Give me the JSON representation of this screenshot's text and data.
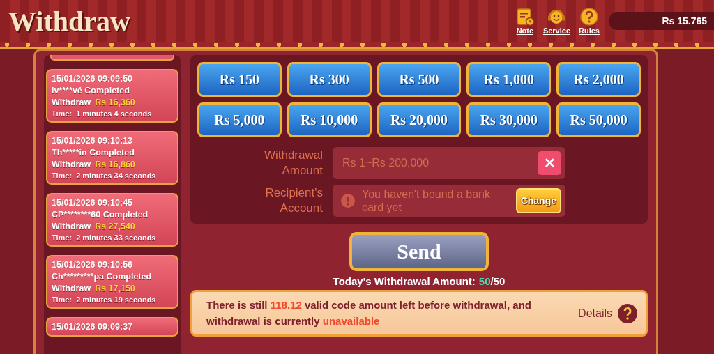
{
  "header": {
    "title": "Withdraw",
    "links": [
      {
        "kind": "note",
        "label": "Note"
      },
      {
        "kind": "service",
        "label": "Service"
      },
      {
        "kind": "rules",
        "label": "Rules"
      }
    ],
    "balance": "Rs 15.765"
  },
  "history": [
    {
      "date": "15/01/2026 09:09:50",
      "user": "Iv****vé Completed",
      "action": "Withdraw",
      "amount": "Rs 16,360",
      "time_label": "Time:",
      "duration": "1 minutes 4 seconds"
    },
    {
      "date": "15/01/2026 09:10:13",
      "user": "Th*****in Completed",
      "action": "Withdraw",
      "amount": "Rs 16,860",
      "time_label": "Time:",
      "duration": "2 minutes 34 seconds"
    },
    {
      "date": "15/01/2026 09:10:45",
      "user": "CP********60 Completed",
      "action": "Withdraw",
      "amount": "Rs 27,540",
      "time_label": "Time:",
      "duration": "2 minutes 33 seconds"
    },
    {
      "date": "15/01/2026 09:10:56",
      "user": "Ch*********pa Completed",
      "action": "Withdraw",
      "amount": "Rs 17,150",
      "time_label": "Time:",
      "duration": "2 minutes 19 seconds"
    },
    {
      "date": "15/01/2026 09:09:37"
    }
  ],
  "amounts": [
    "Rs 150",
    "Rs 300",
    "Rs 500",
    "Rs 1,000",
    "Rs 2,000",
    "Rs 5,000",
    "Rs 10,000",
    "Rs 20,000",
    "Rs 30,000",
    "Rs 50,000"
  ],
  "form": {
    "amount_label": "Withdrawal Amount",
    "amount_placeholder": "Rs 1~Rs 200,000",
    "clear_button": "✕",
    "account_label": "Recipient's Account",
    "account_message": "You haven't bound a bank card yet",
    "change_button": "Change"
  },
  "send_button": "Send",
  "today": {
    "label": "Today's Withdrawal Amount:",
    "used": "50",
    "separator": "/",
    "total": "50"
  },
  "notice": {
    "parts": [
      {
        "text": "There is still ",
        "highlight": false
      },
      {
        "text": "118.12",
        "highlight": true
      },
      {
        "text": " valid code amount left before withdrawal, and withdrawal is currently ",
        "highlight": false
      },
      {
        "text": "unavailable",
        "highlight": true
      }
    ],
    "details_link": "Details"
  }
}
